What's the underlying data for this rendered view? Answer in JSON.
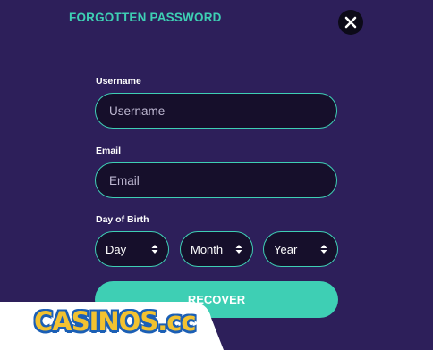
{
  "header": {
    "title": "FORGOTTEN PASSWORD"
  },
  "form": {
    "username": {
      "label": "Username",
      "placeholder": "Username"
    },
    "email": {
      "label": "Email",
      "placeholder": "Email"
    },
    "dob": {
      "label": "Day of Birth",
      "day": "Day",
      "month": "Month",
      "year": "Year"
    },
    "submit_label": "RECOVER"
  },
  "watermark": {
    "text": "CASINOS.cc"
  },
  "colors": {
    "background": "#2d1f5a",
    "accent": "#3ecfb4",
    "input_bg": "#160f2b"
  },
  "icons": {
    "close": "close-icon",
    "select_arrows": "sort-arrows-icon"
  }
}
